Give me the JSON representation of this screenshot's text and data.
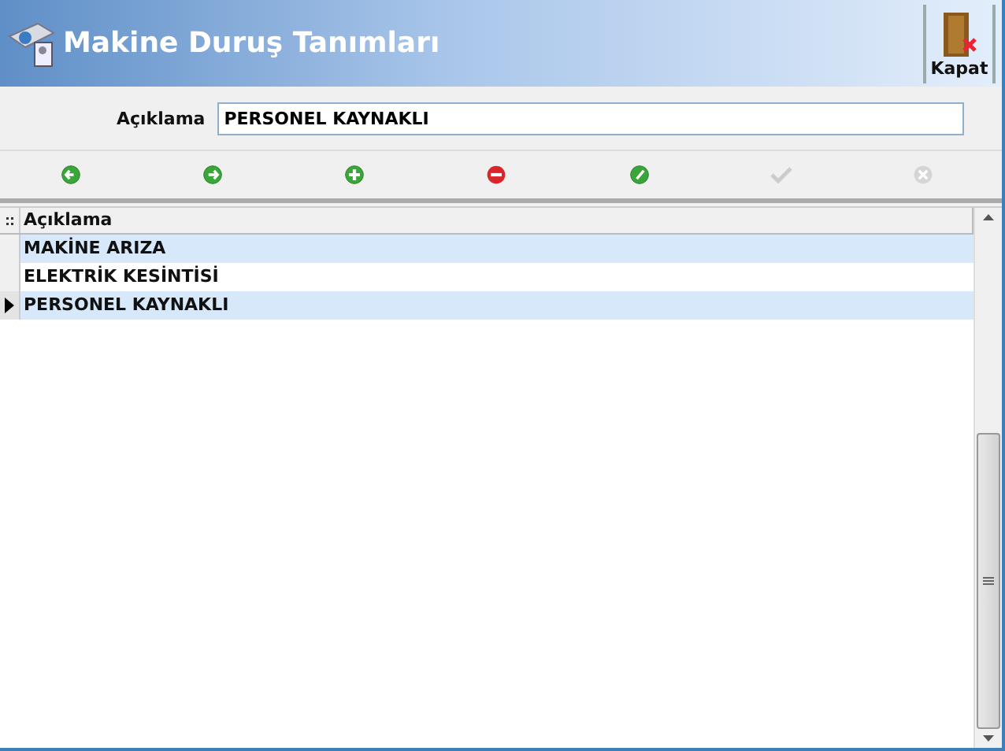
{
  "window": {
    "title": "Makine Duruş Tanımları",
    "close_button": "Kapat"
  },
  "form": {
    "label": "Açıklama",
    "value": "PERSONEL KAYNAKLI"
  },
  "toolbar": [
    {
      "kind": "prev",
      "disabled": false
    },
    {
      "kind": "next",
      "disabled": false
    },
    {
      "kind": "add",
      "disabled": false
    },
    {
      "kind": "delete",
      "disabled": false
    },
    {
      "kind": "edit",
      "disabled": false
    },
    {
      "kind": "save",
      "disabled": true
    },
    {
      "kind": "cancel",
      "disabled": true
    }
  ],
  "table": {
    "columns": [
      "Açıklama"
    ],
    "rows": [
      {
        "cells": [
          "MAKİNE ARIZA"
        ],
        "current": false
      },
      {
        "cells": [
          "ELEKTRİK KESİNTİSİ"
        ],
        "current": false
      },
      {
        "cells": [
          "PERSONEL KAYNAKLI"
        ],
        "current": true
      }
    ]
  }
}
